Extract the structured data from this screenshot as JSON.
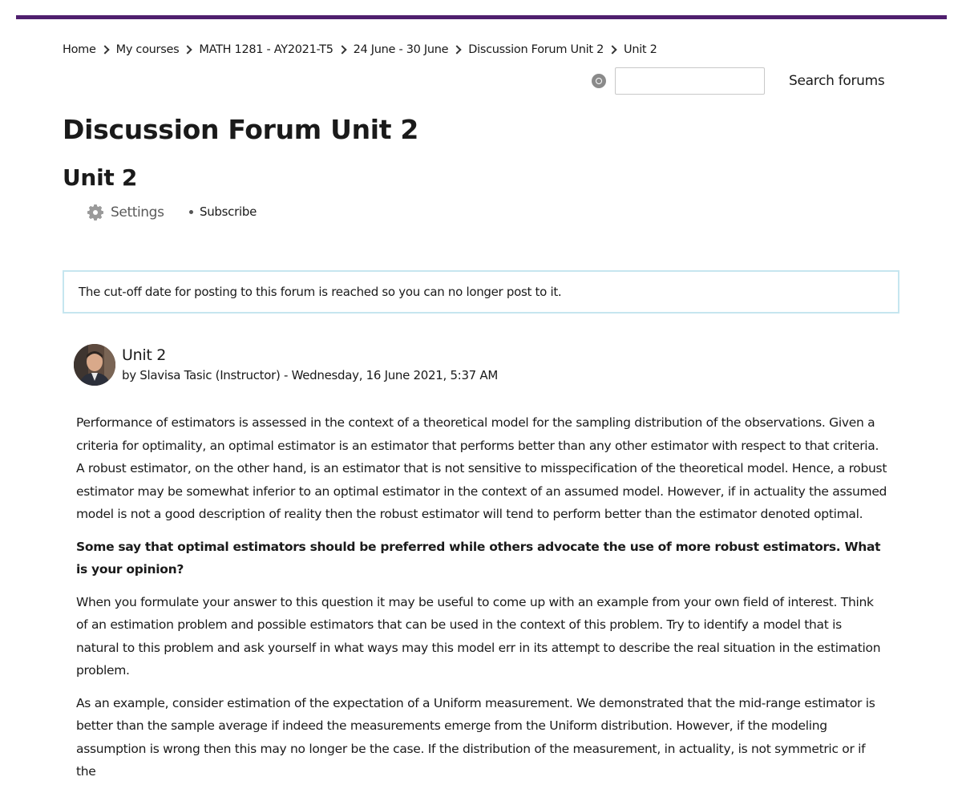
{
  "breadcrumb": [
    "Home",
    "My courses",
    "MATH 1281 - AY2021-T5",
    "24 June - 30 June",
    "Discussion Forum Unit 2",
    "Unit 2"
  ],
  "search": {
    "value": "",
    "placeholder": "",
    "button_label": "Search forums"
  },
  "forum": {
    "title": "Discussion Forum Unit 2",
    "discussion_title": "Unit 2"
  },
  "menu": {
    "settings_label": "Settings",
    "subscribe_label": "Subscribe"
  },
  "notice": {
    "text": "The cut-off date for posting to this forum is reached so you can no longer post to it."
  },
  "post": {
    "subject": "Unit 2",
    "author_line": "by Slavisa Tasic (Instructor) - Wednesday, 16 June 2021, 5:37 AM",
    "paragraphs": [
      "Performance of estimators is assessed in the context of a theoretical model for the sampling distribution of the observations. Given a criteria for optimality, an optimal estimator is an estimator that performs better than any other estimator with respect to that criteria. A robust estimator, on the other hand, is an estimator that is not sensitive to misspecification of the theoretical model. Hence, a robust estimator may be somewhat inferior to an optimal estimator in the context of an assumed model. However, if in actuality the assumed model is not a good description of reality then the robust estimator will tend to perform better than the estimator denoted optimal.",
      "Some say that optimal estimators should be preferred while others advocate the use of more robust estimators. What is your opinion?",
      "When you formulate your answer to this question it may be useful to come up with an example from your own field of interest. Think of an estimation problem and possible estimators that can be used in the context of this problem. Try to identify a model that is natural to this problem and ask yourself in what ways may this model err in its attempt to describe the real situation in the estimation problem.",
      "As an example, consider estimation of the expectation of a Uniform measurement. We demonstrated that the mid-range estimator is better than the sample average if indeed the measurements emerge from the Uniform distribution. However, if the modeling assumption is wrong then this may no longer be the case. If the distribution of the measurement, in actuality, is not symmetric or if the"
    ]
  },
  "colors": {
    "topbar": "#4f1f6e",
    "notice_border": "#c6e6ef"
  }
}
